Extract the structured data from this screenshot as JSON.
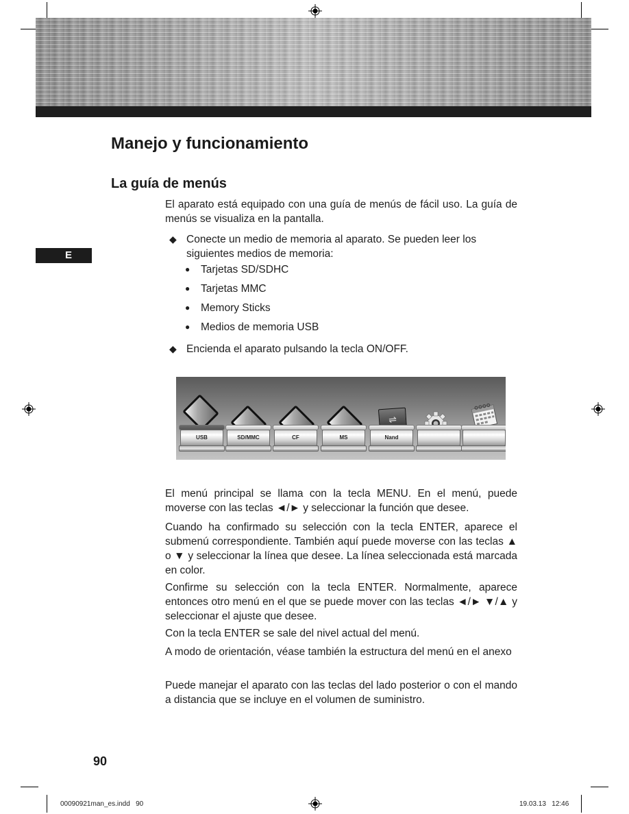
{
  "page": {
    "title": "Manejo y funcionamiento",
    "section_title": "La guía de menús",
    "language_tab": "E",
    "page_number": "90",
    "intro": "El aparato está equipado con una guía de menús de fácil uso. La guía de menús se visualiza en la pantalla.",
    "bullets": [
      {
        "icon": "diamond-bullet-icon",
        "text": "Conecte un medio de memoria al aparato. Se pueden leer los siguientes medios de memoria:",
        "sub_items": [
          "Tarjetas SD/SDHC",
          "Tarjetas MMC",
          "Memory Sticks",
          "Medios de memoria USB"
        ]
      },
      {
        "icon": "diamond-bullet-icon",
        "text": "Encienda el aparato pulsando la tecla ON/OFF."
      }
    ],
    "menu_screenshot": {
      "items": [
        {
          "label": "USB",
          "icon": "memory-card-icon"
        },
        {
          "label": "SD/MMC",
          "icon": "memory-card-icon"
        },
        {
          "label": "CF",
          "icon": "memory-card-icon"
        },
        {
          "label": "MS",
          "icon": "memory-card-icon"
        },
        {
          "label": "Nand",
          "icon": "usb-drive-icon"
        },
        {
          "label": "",
          "icon": "gear-icon"
        },
        {
          "label": "",
          "icon": "calendar-icon"
        }
      ]
    },
    "paragraphs": [
      "El menú principal se llama con la tecla MENU. En el menú, puede moverse con las teclas ◄/► y seleccionar la función que desee.",
      "Cuando ha confirmado su selección con la tecla ENTER, aparece el submenú correspondiente. También aquí puede moverse con las teclas ▲ o ▼ y seleccionar la línea que desee. La línea seleccionada está marcada en color.",
      "Confirme su selección con la tecla ENTER. Normalmente, aparece entonces otro menú en el que se puede mover con las teclas ◄/► ▼/▲ y seleccionar el ajuste que desee.",
      "Con la tecla ENTER se sale del nivel actual del menú.",
      "A modo de orientación, véase también la estructura del menú en el anexo",
      "Puede manejar el aparato con las teclas del lado posterior o con el mando a distancia que se incluye en el volumen de suministro."
    ],
    "slug": {
      "file": "00090921man_es.indd   90",
      "date": "19.03.13   12:46"
    }
  }
}
